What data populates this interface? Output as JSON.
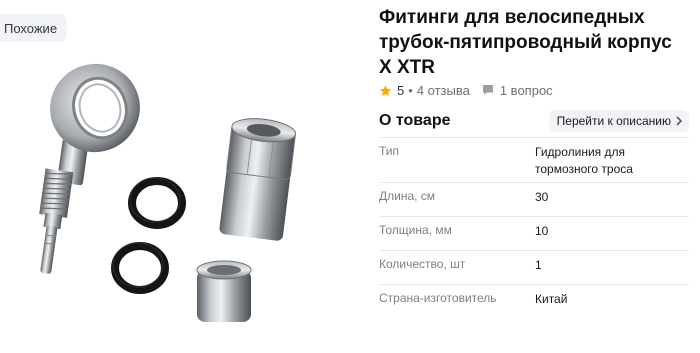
{
  "gallery": {
    "similar_label": "Похожие"
  },
  "product": {
    "title": "Фитинги для велосипедных трубок-пятипроводный корпус X XTR",
    "rating": "5",
    "reviews": "4 отзыва",
    "questions": "1 вопрос",
    "colors": {
      "star": "#ffa800",
      "accent_bg": "#f1f3f6"
    }
  },
  "about": {
    "title": "О товаре",
    "to_description": "Перейти к описанию",
    "specs": [
      {
        "name": "Тип",
        "value": "Гидролиния для тормозного троса"
      },
      {
        "name": "Длина, см",
        "value": "30"
      },
      {
        "name": "Толщина, мм",
        "value": "10"
      },
      {
        "name": "Количество, шт",
        "value": "1"
      },
      {
        "name": "Страна-изготовитель",
        "value": "Китай"
      }
    ]
  }
}
